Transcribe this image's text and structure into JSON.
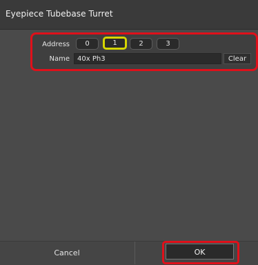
{
  "window": {
    "title": "Eyepiece Tubebase Turret"
  },
  "address": {
    "label": "Address",
    "options": [
      "0",
      "1",
      "2",
      "3"
    ],
    "selected": "1"
  },
  "name": {
    "label": "Name",
    "value": "40x Ph3",
    "clear_label": "Clear"
  },
  "footer": {
    "cancel_label": "Cancel",
    "ok_label": "OK"
  },
  "colors": {
    "highlight_red": "#e0101a",
    "selected_yellow": "#d6d600",
    "background": "#4a4a4a"
  }
}
